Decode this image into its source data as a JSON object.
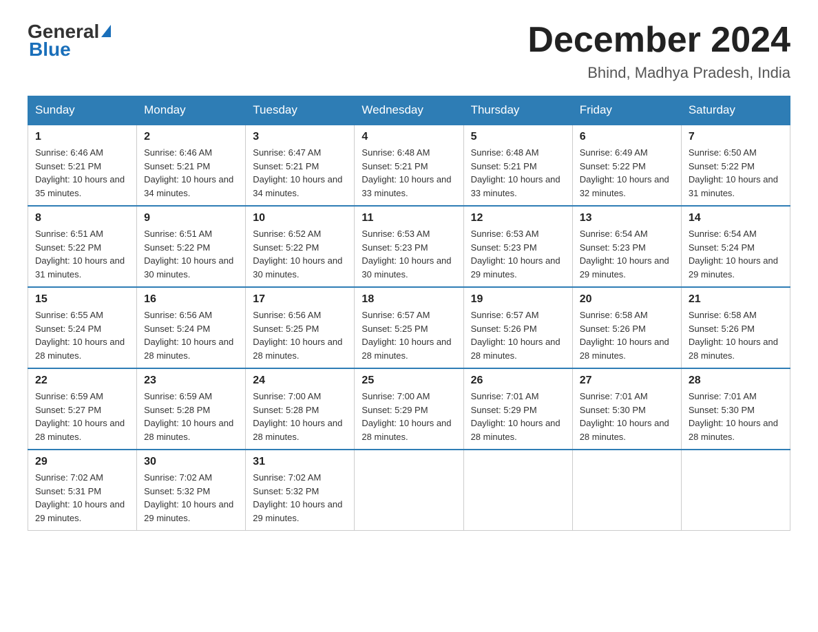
{
  "header": {
    "logo_general": "General",
    "logo_blue": "Blue",
    "main_title": "December 2024",
    "subtitle": "Bhind, Madhya Pradesh, India"
  },
  "days_of_week": [
    "Sunday",
    "Monday",
    "Tuesday",
    "Wednesday",
    "Thursday",
    "Friday",
    "Saturday"
  ],
  "weeks": [
    [
      {
        "day": "1",
        "sunrise": "Sunrise: 6:46 AM",
        "sunset": "Sunset: 5:21 PM",
        "daylight": "Daylight: 10 hours and 35 minutes."
      },
      {
        "day": "2",
        "sunrise": "Sunrise: 6:46 AM",
        "sunset": "Sunset: 5:21 PM",
        "daylight": "Daylight: 10 hours and 34 minutes."
      },
      {
        "day": "3",
        "sunrise": "Sunrise: 6:47 AM",
        "sunset": "Sunset: 5:21 PM",
        "daylight": "Daylight: 10 hours and 34 minutes."
      },
      {
        "day": "4",
        "sunrise": "Sunrise: 6:48 AM",
        "sunset": "Sunset: 5:21 PM",
        "daylight": "Daylight: 10 hours and 33 minutes."
      },
      {
        "day": "5",
        "sunrise": "Sunrise: 6:48 AM",
        "sunset": "Sunset: 5:21 PM",
        "daylight": "Daylight: 10 hours and 33 minutes."
      },
      {
        "day": "6",
        "sunrise": "Sunrise: 6:49 AM",
        "sunset": "Sunset: 5:22 PM",
        "daylight": "Daylight: 10 hours and 32 minutes."
      },
      {
        "day": "7",
        "sunrise": "Sunrise: 6:50 AM",
        "sunset": "Sunset: 5:22 PM",
        "daylight": "Daylight: 10 hours and 31 minutes."
      }
    ],
    [
      {
        "day": "8",
        "sunrise": "Sunrise: 6:51 AM",
        "sunset": "Sunset: 5:22 PM",
        "daylight": "Daylight: 10 hours and 31 minutes."
      },
      {
        "day": "9",
        "sunrise": "Sunrise: 6:51 AM",
        "sunset": "Sunset: 5:22 PM",
        "daylight": "Daylight: 10 hours and 30 minutes."
      },
      {
        "day": "10",
        "sunrise": "Sunrise: 6:52 AM",
        "sunset": "Sunset: 5:22 PM",
        "daylight": "Daylight: 10 hours and 30 minutes."
      },
      {
        "day": "11",
        "sunrise": "Sunrise: 6:53 AM",
        "sunset": "Sunset: 5:23 PM",
        "daylight": "Daylight: 10 hours and 30 minutes."
      },
      {
        "day": "12",
        "sunrise": "Sunrise: 6:53 AM",
        "sunset": "Sunset: 5:23 PM",
        "daylight": "Daylight: 10 hours and 29 minutes."
      },
      {
        "day": "13",
        "sunrise": "Sunrise: 6:54 AM",
        "sunset": "Sunset: 5:23 PM",
        "daylight": "Daylight: 10 hours and 29 minutes."
      },
      {
        "day": "14",
        "sunrise": "Sunrise: 6:54 AM",
        "sunset": "Sunset: 5:24 PM",
        "daylight": "Daylight: 10 hours and 29 minutes."
      }
    ],
    [
      {
        "day": "15",
        "sunrise": "Sunrise: 6:55 AM",
        "sunset": "Sunset: 5:24 PM",
        "daylight": "Daylight: 10 hours and 28 minutes."
      },
      {
        "day": "16",
        "sunrise": "Sunrise: 6:56 AM",
        "sunset": "Sunset: 5:24 PM",
        "daylight": "Daylight: 10 hours and 28 minutes."
      },
      {
        "day": "17",
        "sunrise": "Sunrise: 6:56 AM",
        "sunset": "Sunset: 5:25 PM",
        "daylight": "Daylight: 10 hours and 28 minutes."
      },
      {
        "day": "18",
        "sunrise": "Sunrise: 6:57 AM",
        "sunset": "Sunset: 5:25 PM",
        "daylight": "Daylight: 10 hours and 28 minutes."
      },
      {
        "day": "19",
        "sunrise": "Sunrise: 6:57 AM",
        "sunset": "Sunset: 5:26 PM",
        "daylight": "Daylight: 10 hours and 28 minutes."
      },
      {
        "day": "20",
        "sunrise": "Sunrise: 6:58 AM",
        "sunset": "Sunset: 5:26 PM",
        "daylight": "Daylight: 10 hours and 28 minutes."
      },
      {
        "day": "21",
        "sunrise": "Sunrise: 6:58 AM",
        "sunset": "Sunset: 5:26 PM",
        "daylight": "Daylight: 10 hours and 28 minutes."
      }
    ],
    [
      {
        "day": "22",
        "sunrise": "Sunrise: 6:59 AM",
        "sunset": "Sunset: 5:27 PM",
        "daylight": "Daylight: 10 hours and 28 minutes."
      },
      {
        "day": "23",
        "sunrise": "Sunrise: 6:59 AM",
        "sunset": "Sunset: 5:28 PM",
        "daylight": "Daylight: 10 hours and 28 minutes."
      },
      {
        "day": "24",
        "sunrise": "Sunrise: 7:00 AM",
        "sunset": "Sunset: 5:28 PM",
        "daylight": "Daylight: 10 hours and 28 minutes."
      },
      {
        "day": "25",
        "sunrise": "Sunrise: 7:00 AM",
        "sunset": "Sunset: 5:29 PM",
        "daylight": "Daylight: 10 hours and 28 minutes."
      },
      {
        "day": "26",
        "sunrise": "Sunrise: 7:01 AM",
        "sunset": "Sunset: 5:29 PM",
        "daylight": "Daylight: 10 hours and 28 minutes."
      },
      {
        "day": "27",
        "sunrise": "Sunrise: 7:01 AM",
        "sunset": "Sunset: 5:30 PM",
        "daylight": "Daylight: 10 hours and 28 minutes."
      },
      {
        "day": "28",
        "sunrise": "Sunrise: 7:01 AM",
        "sunset": "Sunset: 5:30 PM",
        "daylight": "Daylight: 10 hours and 28 minutes."
      }
    ],
    [
      {
        "day": "29",
        "sunrise": "Sunrise: 7:02 AM",
        "sunset": "Sunset: 5:31 PM",
        "daylight": "Daylight: 10 hours and 29 minutes."
      },
      {
        "day": "30",
        "sunrise": "Sunrise: 7:02 AM",
        "sunset": "Sunset: 5:32 PM",
        "daylight": "Daylight: 10 hours and 29 minutes."
      },
      {
        "day": "31",
        "sunrise": "Sunrise: 7:02 AM",
        "sunset": "Sunset: 5:32 PM",
        "daylight": "Daylight: 10 hours and 29 minutes."
      },
      null,
      null,
      null,
      null
    ]
  ]
}
